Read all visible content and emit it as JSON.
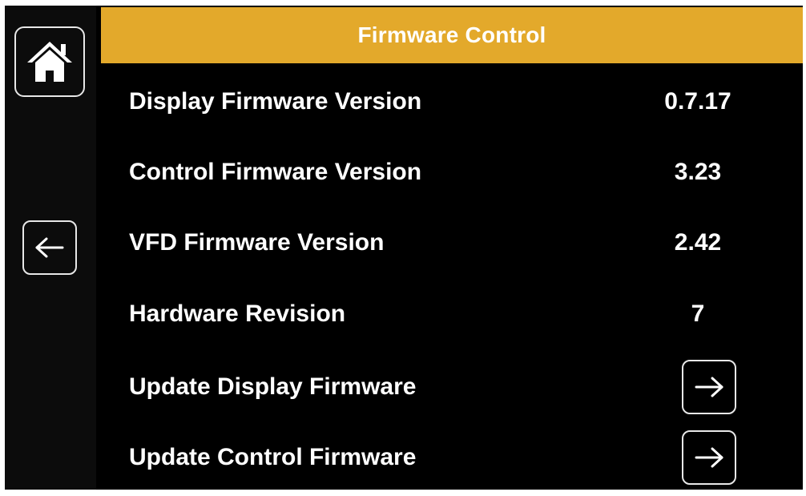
{
  "header": {
    "title": "Firmware Control",
    "color": "#e3a92b"
  },
  "sidebar": {
    "home_icon": "home-icon",
    "back_icon": "arrow-left-icon"
  },
  "rows": [
    {
      "label": "Display Firmware Version",
      "value": "0.7.17"
    },
    {
      "label": "Control Firmware Version",
      "value": "3.23"
    },
    {
      "label": "VFD Firmware Version",
      "value": "2.42"
    },
    {
      "label": "Hardware Revision",
      "value": "7"
    },
    {
      "label": "Update Display Firmware",
      "action_icon": "arrow-right-icon"
    },
    {
      "label": "Update Control Firmware",
      "action_icon": "arrow-right-icon"
    }
  ]
}
